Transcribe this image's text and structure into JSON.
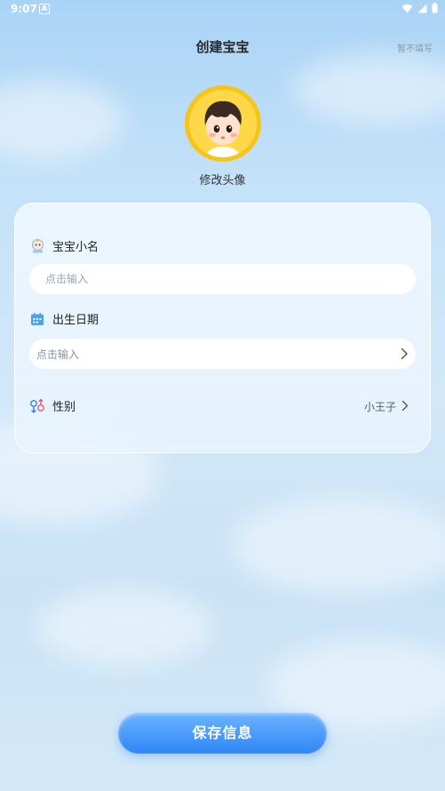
{
  "status_bar": {
    "time": "9:07",
    "notification_badge": "A"
  },
  "header": {
    "title": "创建宝宝",
    "skip_label": "暂不填写"
  },
  "avatar": {
    "caption": "修改头像"
  },
  "form": {
    "name": {
      "label": "宝宝小名",
      "placeholder": "点击输入",
      "icon": "baby-icon"
    },
    "birthday": {
      "label": "出生日期",
      "placeholder": "点击输入",
      "icon": "calendar-icon"
    },
    "gender": {
      "label": "性别",
      "value": "小王子",
      "icon": "gender-icon"
    }
  },
  "save_button": {
    "label": "保存信息"
  },
  "colors": {
    "accent": "#2f86f5",
    "avatar_ring": "#f6c51a"
  }
}
